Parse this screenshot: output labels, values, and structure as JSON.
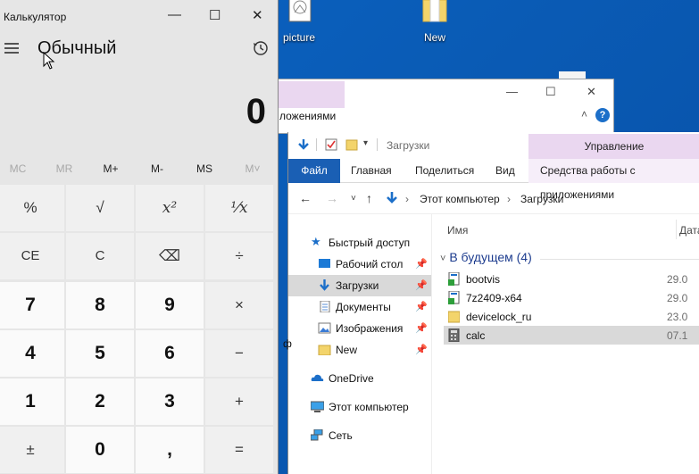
{
  "desktop": {
    "icons": [
      {
        "label": "picture",
        "icon": "image-file-icon"
      },
      {
        "label": "New",
        "icon": "folder-icon"
      }
    ]
  },
  "back_window": {
    "caption": "ложениями",
    "controls": [
      "—",
      "☐",
      "✕"
    ],
    "help": "?"
  },
  "explorer": {
    "title": "Загрузки",
    "manage_tab": "Управление",
    "tabs": {
      "file": "Файл",
      "home": "Главная",
      "share": "Поделиться",
      "view": "Вид",
      "tools": "Средства работы с приложениями"
    },
    "breadcrumb": [
      "Этот компьютер",
      "Загрузки"
    ],
    "tree": [
      {
        "label": "Быстрый доступ",
        "icon": "star-icon",
        "pin": false
      },
      {
        "label": "Рабочий стол",
        "icon": "desktop-icon",
        "pin": true
      },
      {
        "label": "Загрузки",
        "icon": "download-icon",
        "pin": true,
        "selected": true
      },
      {
        "label": "Документы",
        "icon": "documents-icon",
        "pin": true
      },
      {
        "label": "Изображения",
        "icon": "pictures-icon",
        "pin": true
      },
      {
        "label": "New",
        "icon": "folder-icon",
        "pin": true
      },
      {
        "label": "OneDrive",
        "icon": "cloud-icon",
        "pin": false
      },
      {
        "label": "Этот компьютер",
        "icon": "computer-icon",
        "pin": false
      },
      {
        "label": "Сеть",
        "icon": "network-icon",
        "pin": false
      }
    ],
    "columns": {
      "name": "Имя",
      "date": "Дата"
    },
    "group": "В будущем (4)",
    "files": [
      {
        "name": "bootvis",
        "date": "29.0",
        "icon": "installer-icon"
      },
      {
        "name": "7z2409-x64",
        "date": "29.0",
        "icon": "installer-icon"
      },
      {
        "name": "devicelock_ru",
        "date": "23.0",
        "icon": "folder-icon"
      },
      {
        "name": "calc",
        "date": "07.1",
        "icon": "calculator-file-icon",
        "selected": true
      }
    ],
    "stray_char": "ф"
  },
  "calculator": {
    "title": "Калькулятор",
    "window_controls": [
      "—",
      "☐",
      "✕"
    ],
    "mode": "Обычный",
    "display": "0",
    "memory": [
      {
        "label": "MC",
        "enabled": false
      },
      {
        "label": "MR",
        "enabled": false
      },
      {
        "label": "M+",
        "enabled": true
      },
      {
        "label": "M-",
        "enabled": true
      },
      {
        "label": "MS",
        "enabled": true
      },
      {
        "label": "M˅",
        "enabled": false
      }
    ],
    "keys": [
      [
        "%",
        "√",
        "x²",
        "¹⁄x"
      ],
      [
        "CE",
        "C",
        "⌫",
        "÷"
      ],
      [
        "7",
        "8",
        "9",
        "×"
      ],
      [
        "4",
        "5",
        "6",
        "−"
      ],
      [
        "1",
        "2",
        "3",
        "+"
      ],
      [
        "±",
        "0",
        ",",
        "="
      ]
    ]
  }
}
